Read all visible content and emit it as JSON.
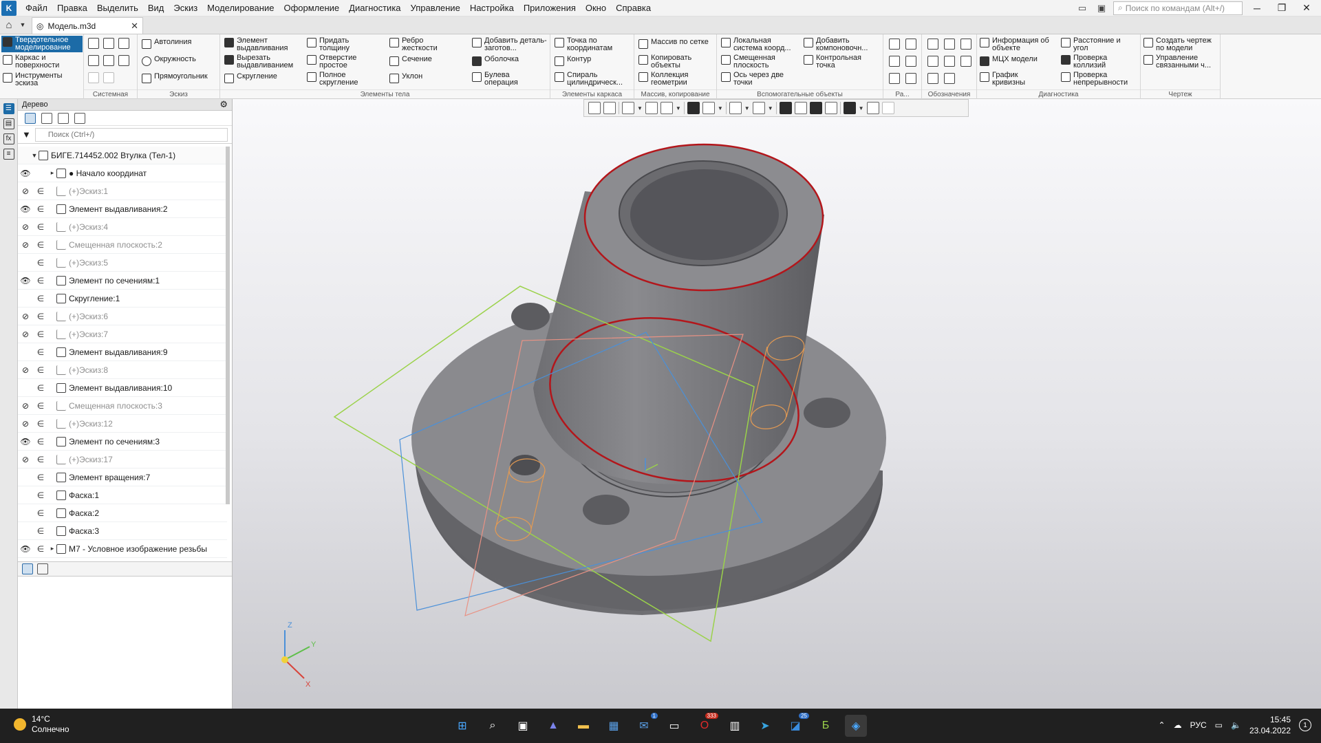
{
  "app": {
    "logo_text": "K",
    "menu": [
      "Файл",
      "Правка",
      "Выделить",
      "Вид",
      "Эскиз",
      "Моделирование",
      "Оформление",
      "Диагностика",
      "Управление",
      "Настройка",
      "Приложения",
      "Окно",
      "Справка"
    ],
    "command_search_placeholder": "Поиск по командам (Alt+/)"
  },
  "tabs": {
    "doc_tab": "Модель.m3d"
  },
  "ribbon": {
    "modes": [
      "Твердотельное моделирование",
      "Каркас и поверхности",
      "Инструменты эскиза"
    ],
    "groups": {
      "system": "Системная",
      "sketch": "Эскиз",
      "body": "Элементы тела",
      "frame": "Элементы каркаса",
      "array": "Массив, копирование",
      "aux": "Вспомогательные объекты",
      "ra": "Ра...",
      "marks": "Обозначения",
      "diag": "Диагностика",
      "drawing": "Чертеж"
    },
    "sketch_btns": [
      "Автолиния",
      "Окружность",
      "Прямоугольник"
    ],
    "body_btns": [
      "Элемент выдавливания",
      "Вырезать выдавливанием",
      "Скругление",
      "Придать толщину",
      "Отверстие простое",
      "Полное скругление",
      "Ребро жесткости",
      "Сечение",
      "Уклон",
      "Добавить деталь-заготов...",
      "Оболочка",
      "Булева операция"
    ],
    "frame_btns": [
      "Точка по координатам",
      "Контур",
      "Спираль цилиндрическ..."
    ],
    "array_btns": [
      "Массив по сетке",
      "Копировать объекты",
      "Коллекция геометрии"
    ],
    "aux_btns": [
      "Локальная система коорд...",
      "Смещенная плоскость",
      "Ось через две точки",
      "Добавить компоновочн...",
      "Контрольная точка"
    ],
    "diag_btns": [
      "Информация об объекте",
      "МЦХ модели",
      "График кривизны",
      "Расстояние и угол",
      "Проверка коллизий",
      "Проверка непрерывности"
    ],
    "drawing_btns": [
      "Создать чертеж по модели",
      "Управление связанными ч..."
    ]
  },
  "tree": {
    "title": "Дерево",
    "search_placeholder": "Поиск (Ctrl+/)",
    "items": [
      {
        "label": "БИГЕ.714452.002 Втулка (Тел-1)",
        "eye": "",
        "inc": "",
        "dim": false
      },
      {
        "label": "● Начало координат",
        "eye": "👁",
        "inc": "",
        "dim": false
      },
      {
        "label": "(+)Эскиз:1",
        "eye": "⊘",
        "inc": "∈",
        "dim": true
      },
      {
        "label": "Элемент выдавливания:2",
        "eye": "👁",
        "inc": "∈",
        "dim": false
      },
      {
        "label": "(+)Эскиз:4",
        "eye": "⊘",
        "inc": "∈",
        "dim": true
      },
      {
        "label": "Смещенная плоскость:2",
        "eye": "⊘",
        "inc": "∈",
        "dim": true
      },
      {
        "label": "(+)Эскиз:5",
        "eye": "",
        "inc": "∈",
        "dim": true
      },
      {
        "label": "Элемент по сечениям:1",
        "eye": "👁",
        "inc": "∈",
        "dim": false
      },
      {
        "label": "Скругление:1",
        "eye": "",
        "inc": "∈",
        "dim": false
      },
      {
        "label": "(+)Эскиз:6",
        "eye": "⊘",
        "inc": "∈",
        "dim": true
      },
      {
        "label": "(+)Эскиз:7",
        "eye": "⊘",
        "inc": "∈",
        "dim": true
      },
      {
        "label": "Элемент выдавливания:9",
        "eye": "",
        "inc": "∈",
        "dim": false
      },
      {
        "label": "(+)Эскиз:8",
        "eye": "⊘",
        "inc": "∈",
        "dim": true
      },
      {
        "label": "Элемент выдавливания:10",
        "eye": "",
        "inc": "∈",
        "dim": false
      },
      {
        "label": "Смещенная плоскость:3",
        "eye": "⊘",
        "inc": "∈",
        "dim": true
      },
      {
        "label": "(+)Эскиз:12",
        "eye": "⊘",
        "inc": "∈",
        "dim": true
      },
      {
        "label": "Элемент по сечениям:3",
        "eye": "👁",
        "inc": "∈",
        "dim": false
      },
      {
        "label": "(+)Эскиз:17",
        "eye": "⊘",
        "inc": "∈",
        "dim": true
      },
      {
        "label": "Элемент вращения:7",
        "eye": "",
        "inc": "∈",
        "dim": false
      },
      {
        "label": "Фаска:1",
        "eye": "",
        "inc": "∈",
        "dim": false
      },
      {
        "label": "Фаска:2",
        "eye": "",
        "inc": "∈",
        "dim": false
      },
      {
        "label": "Фаска:3",
        "eye": "",
        "inc": "∈",
        "dim": false
      },
      {
        "label": "M7 - Условное изображение резьбы",
        "eye": "👁",
        "inc": "∈",
        "dim": false
      }
    ]
  },
  "axes": {
    "z": "Z",
    "y": "Y",
    "x": "X"
  },
  "taskbar": {
    "temp": "14°C",
    "weather": "Солнечно",
    "lang": "РУС",
    "time": "15:45",
    "date": "23.04.2022",
    "notif": "1",
    "badge_mail": "1",
    "badge_opera": "333",
    "badge_tg": "25"
  }
}
